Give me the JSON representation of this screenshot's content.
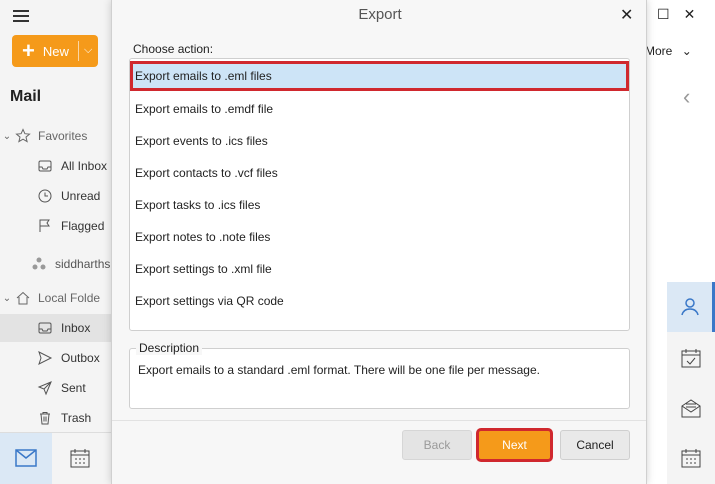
{
  "app": {
    "new_label": "New",
    "mail_title": "Mail",
    "more_label": "More",
    "nav": [
      {
        "label": "Favorites",
        "icon": "star-icon"
      },
      {
        "label": "All Inbox",
        "icon": "inbox-icon"
      },
      {
        "label": "Unread",
        "icon": "clock-icon"
      },
      {
        "label": "Flagged",
        "icon": "flag-icon"
      },
      {
        "label": "siddharths",
        "icon": "account-icon"
      },
      {
        "label": "Local Folde",
        "icon": "home-icon"
      },
      {
        "label": "Inbox",
        "icon": "inbox-icon"
      },
      {
        "label": "Outbox",
        "icon": "send-icon"
      },
      {
        "label": "Sent",
        "icon": "sent-icon"
      },
      {
        "label": "Trash",
        "icon": "trash-icon"
      }
    ]
  },
  "dialog": {
    "title": "Export",
    "choose_label": "Choose action:",
    "actions": [
      "Export emails to .eml files",
      "Export emails to .emdf file",
      "Export events to .ics files",
      "Export contacts to .vcf files",
      "Export tasks to .ics files",
      "Export notes to .note files",
      "Export settings to .xml file",
      "Export settings via QR code"
    ],
    "selected_index": 0,
    "description_label": "Description",
    "description_text": "Export emails to a standard .eml format. There will be one file per message.",
    "back_label": "Back",
    "next_label": "Next",
    "cancel_label": "Cancel"
  },
  "colors": {
    "accent": "#f59a1a",
    "highlight_border": "#d0282e",
    "selection_bg": "#cde4f7"
  }
}
